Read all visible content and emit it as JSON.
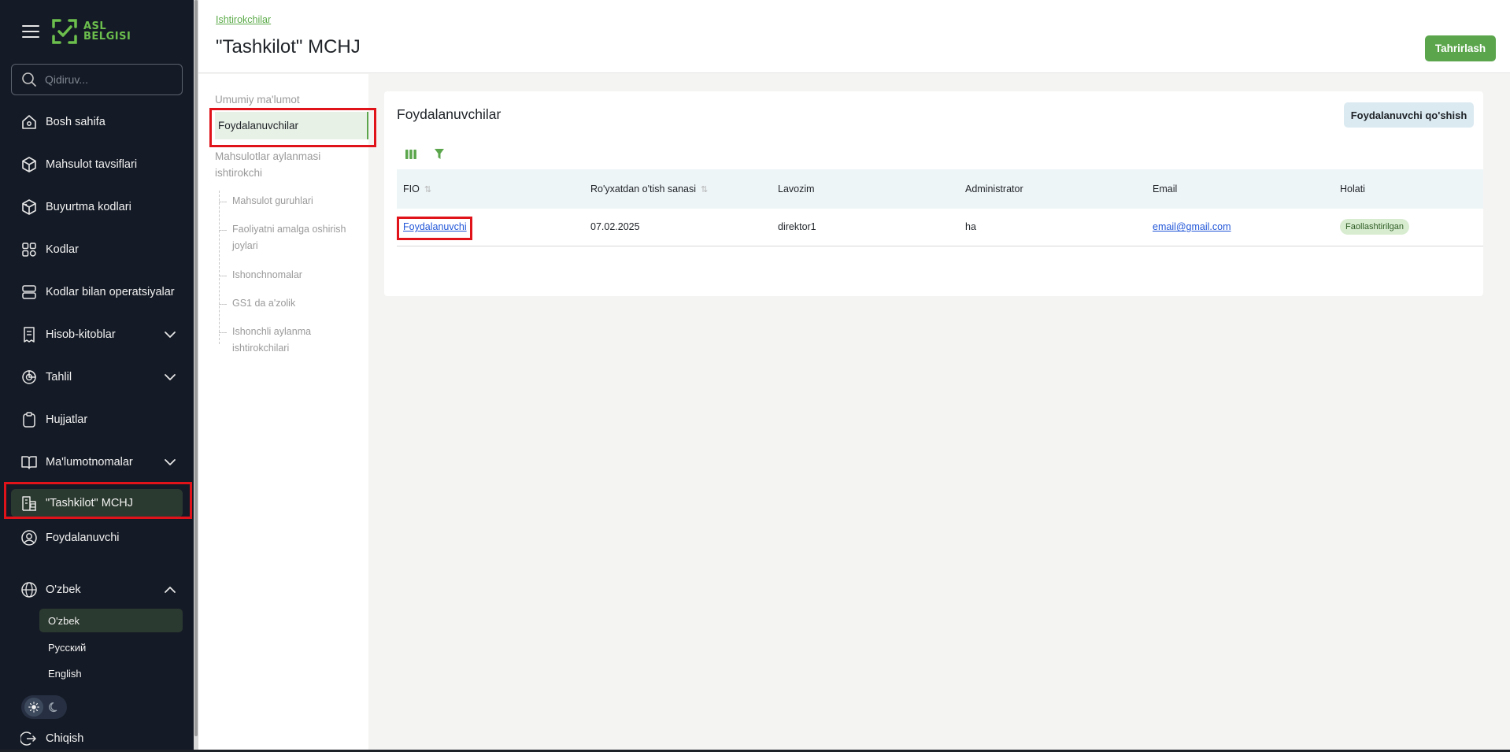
{
  "sidebar": {
    "logo": {
      "line1": "ASL",
      "line2": "BELGISI",
      "color": "#6cbf4d"
    },
    "search_placeholder": "Qidiruv...",
    "items": [
      {
        "label": "Bosh sahifa",
        "icon": "home-icon"
      },
      {
        "label": "Mahsulot tavsiflari",
        "icon": "box-icon"
      },
      {
        "label": "Buyurtma kodlari",
        "icon": "box-order-icon"
      },
      {
        "label": "Kodlar",
        "icon": "codes-grid-icon"
      },
      {
        "label": "Kodlar bilan operatsiyalar",
        "icon": "operations-icon"
      },
      {
        "label": "Hisob-kitoblar",
        "icon": "receipt-icon",
        "expandable": true
      },
      {
        "label": "Tahlil",
        "icon": "analytics-icon",
        "expandable": true
      },
      {
        "label": "Hujjatlar",
        "icon": "clipboard-icon"
      },
      {
        "label": "Ma'lumotnomalar",
        "icon": "book-icon",
        "expandable": true
      },
      {
        "label": "\"Tashkilot\" MCHJ",
        "icon": "organization-icon",
        "active": true
      },
      {
        "label": "Foydalanuvchi",
        "icon": "user-icon"
      }
    ],
    "language": {
      "label": "O'zbek",
      "icon": "globe-icon",
      "options": [
        {
          "label": "O'zbek",
          "active": true
        },
        {
          "label": "Русский"
        },
        {
          "label": "English"
        }
      ]
    },
    "logout_label": "Chiqish"
  },
  "header": {
    "breadcrumb": "Ishtirokchilar",
    "title": "\"Tashkilot\" MCHJ",
    "edit_label": "Tahrirlash"
  },
  "subnav": {
    "general": "Umumiy ma'lumot",
    "users": "Foydalanuvchilar",
    "participant": "Mahsulotlar aylanmasi ishtirokchi",
    "children": [
      "Mahsulot guruhlari",
      "Faoliyatni amalga oshirish joylari",
      "Ishonchnomalar",
      "GS1 da a'zolik",
      "Ishonchli aylanma ishtirokchilari"
    ]
  },
  "main": {
    "title": "Foydalanuvchilar",
    "add_label": "Foydalanuvchi qo'shish",
    "columns": [
      "FIO",
      "Ro'yxatdan o'tish sanasi",
      "Lavozim",
      "Administrator",
      "Email",
      "Holati"
    ],
    "rows": [
      {
        "fio": "Foydalanuvchi",
        "date": "07.02.2025",
        "position": "direktor1",
        "admin": "ha",
        "email": "email@gmail.com",
        "status": "Faollashtirilgan"
      }
    ]
  },
  "colors": {
    "accent": "#5ba64c",
    "sidebar_bg": "#151b26",
    "highlight": "#e0121a"
  }
}
